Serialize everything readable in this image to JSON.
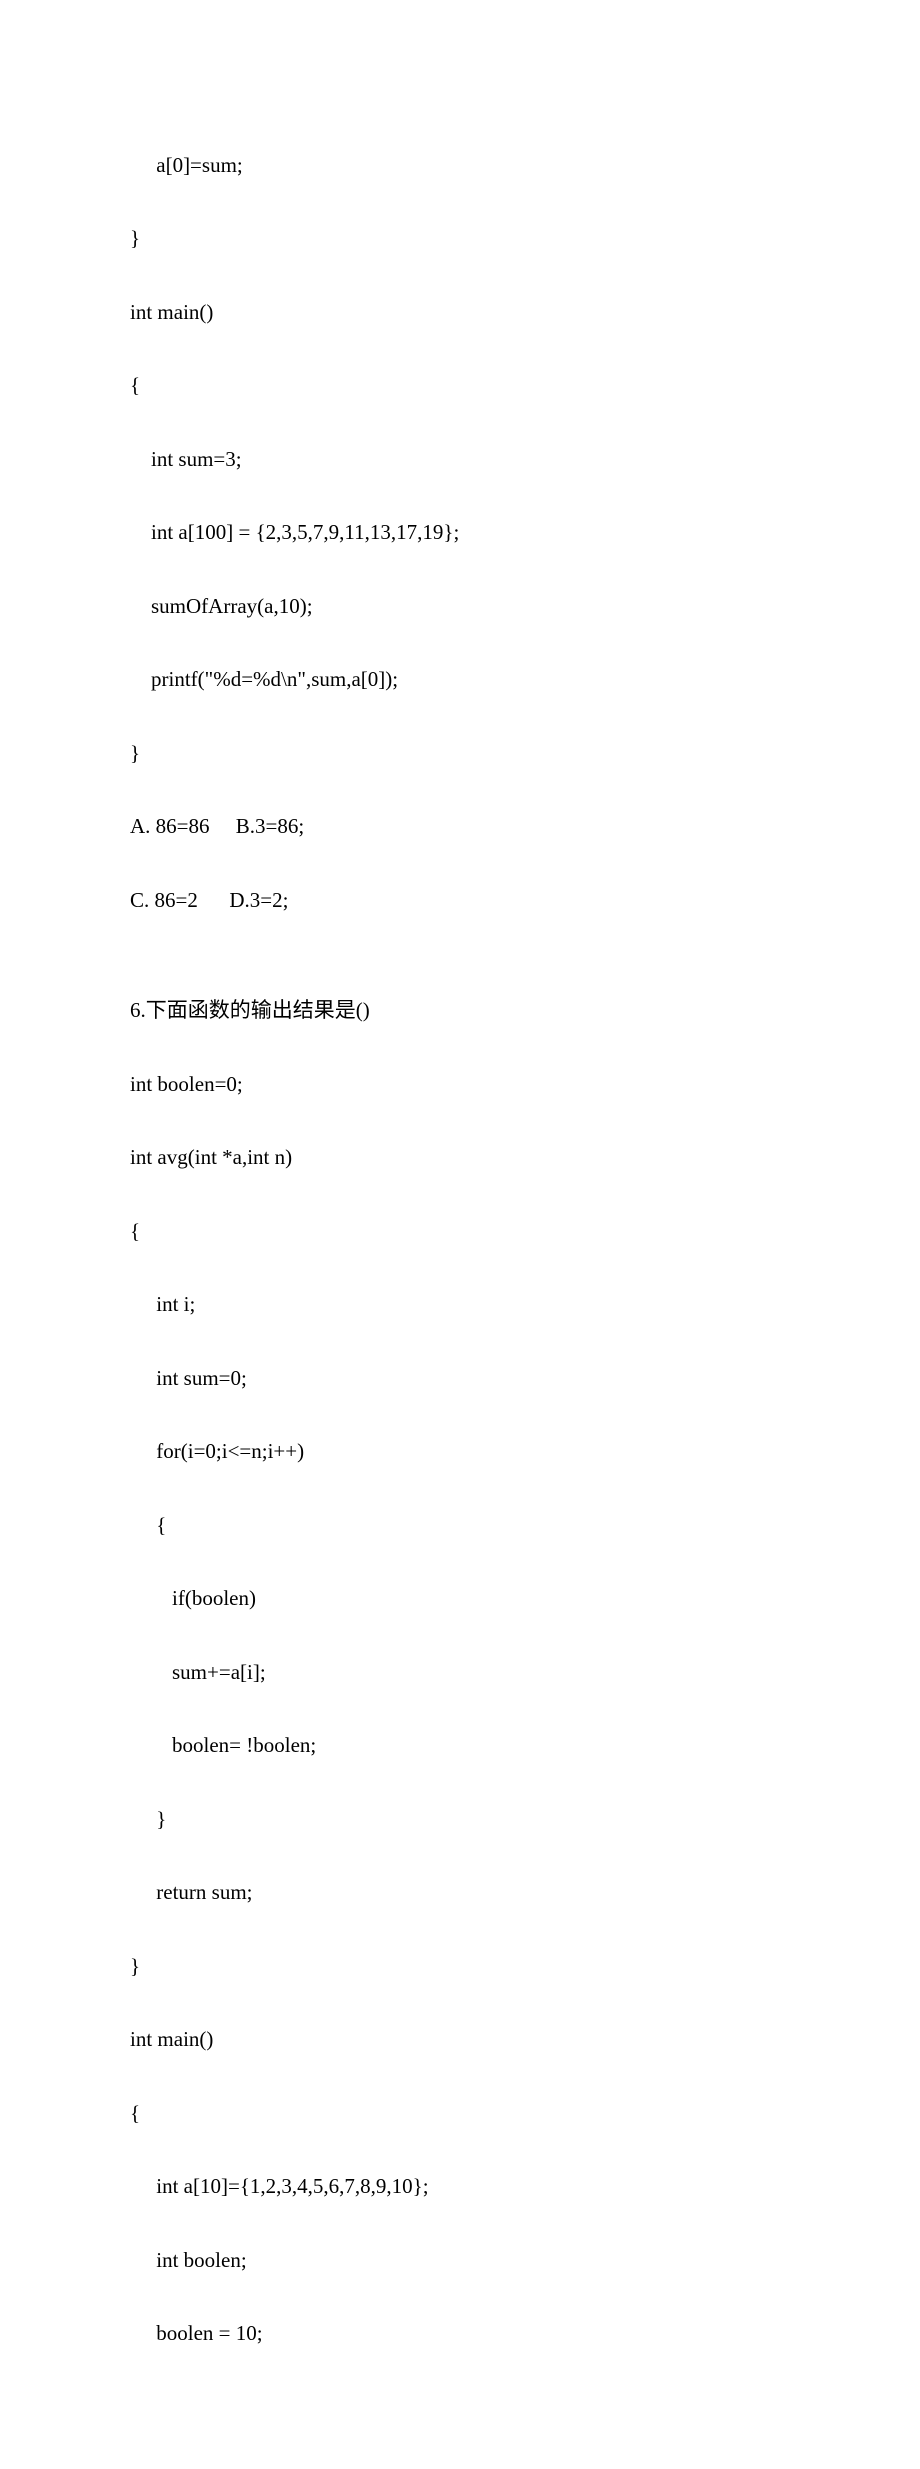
{
  "lines": [
    "     a[0]=sum;",
    "}",
    "int main()",
    "{",
    "    int sum=3;",
    "    int a[100] = {2,3,5,7,9,11,13,17,19};",
    "    sumOfArray(a,10);",
    "    printf(\"%d=%d\\n\",sum,a[0]);",
    "}",
    "A. 86=86     B.3=86;",
    "C. 86=2      D.3=2;",
    "",
    "6.下面函数的输出结果是()",
    "int boolen=0;",
    "int avg(int *a,int n)",
    "{",
    "     int i;",
    "     int sum=0;",
    "     for(i=0;i<=n;i++)",
    "     {",
    "        if(boolen)",
    "        sum+=a[i];",
    "        boolen= !boolen;",
    "     }",
    "     return sum;",
    "}",
    "int main()",
    "{",
    "     int a[10]={1,2,3,4,5,6,7,8,9,10};",
    "     int boolen;",
    "     boolen = 10;"
  ]
}
